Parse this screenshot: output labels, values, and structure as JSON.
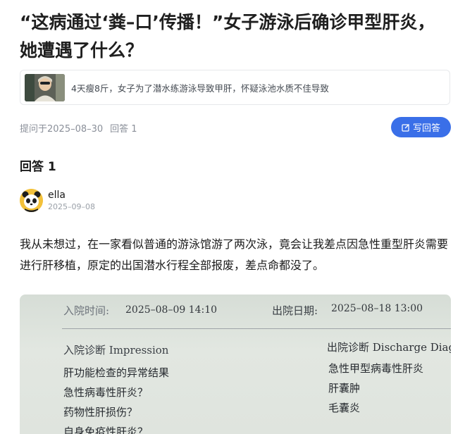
{
  "question": {
    "title": "“这病通过‘粪–口’传播！”女子游泳后确诊甲型肝炎，她遭遇了什么？"
  },
  "reference": {
    "text": "4天瘦8斤，女子为了潜水练游泳导致甲肝，怀疑泳池水质不佳导致"
  },
  "meta": {
    "asked_label": "提问于2025–08–30",
    "answer_count_label": "回答 1"
  },
  "actions": {
    "write_answer_label": "写回答"
  },
  "answers_heading": "回答 1",
  "answer": {
    "author_name": "ella",
    "author_date": "2025–09–08",
    "body": "我从未想过，在一家看似普通的游泳馆游了两次泳，竟会让我差点因急性重型肝炎需要进行肝移植，原定的出国潜水行程全部报废，差点命都没了。"
  },
  "photo": {
    "admit_label": "入院时间:",
    "admit_value": "2025–08–09 14:10",
    "discharge_label": "出院日期:",
    "discharge_value": "2025–08–18 13:00",
    "admit_dx_heading": "入院诊断 Impression",
    "admit_dx_items": [
      "肝功能检查的异常结果",
      "急性病毒性肝炎？",
      "药物性肝损伤？",
      "自身免疫性肝炎？"
    ],
    "discharge_dx_heading": "出院诊断 Discharge Diagnos",
    "discharge_dx_items": [
      "急性甲型病毒性肝炎",
      "肝囊肿",
      "毛囊炎"
    ]
  }
}
